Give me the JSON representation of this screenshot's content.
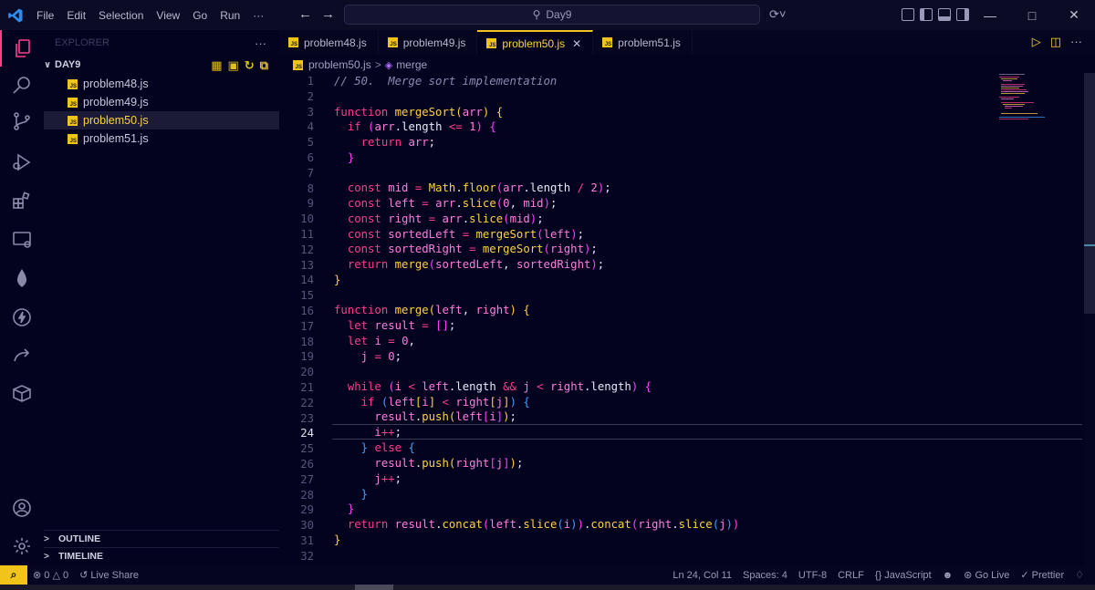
{
  "menu": [
    "File",
    "Edit",
    "Selection",
    "View",
    "Go",
    "Run",
    "···"
  ],
  "command_center": "Day9",
  "sidebar": {
    "header": "EXPLORER",
    "folder": "DAY9",
    "files": [
      "problem48.js",
      "problem49.js",
      "problem50.js",
      "problem51.js"
    ],
    "selected": "problem50.js",
    "outline": "OUTLINE",
    "timeline": "TIMELINE"
  },
  "tabs": [
    "problem48.js",
    "problem49.js",
    "problem50.js",
    "problem51.js"
  ],
  "active_tab": "problem50.js",
  "breadcrumb": {
    "file": "problem50.js",
    "symbol": "merge"
  },
  "editor": {
    "current_line": 24,
    "line_numbers": [
      "1",
      "2",
      "3",
      "4",
      "5",
      "6",
      "7",
      "8",
      "9",
      "10",
      "11",
      "12",
      "13",
      "14",
      "15",
      "16",
      "17",
      "18",
      "19",
      "20",
      "21",
      "22",
      "23",
      "24",
      "25",
      "26",
      "27",
      "28",
      "29",
      "30",
      "31",
      "32"
    ]
  },
  "statusbar": {
    "problems": "0",
    "warnings": "0",
    "live_share": "Live Share",
    "position": "Ln 24, Col 11",
    "spaces": "Spaces: 4",
    "encoding": "UTF-8",
    "eol": "CRLF",
    "language": "JavaScript",
    "golive": "Go Live",
    "prettier": "Prettier"
  },
  "colors": {
    "accent": "#ff3d8b",
    "active_file": "#ffd23f",
    "background": "#030320"
  }
}
